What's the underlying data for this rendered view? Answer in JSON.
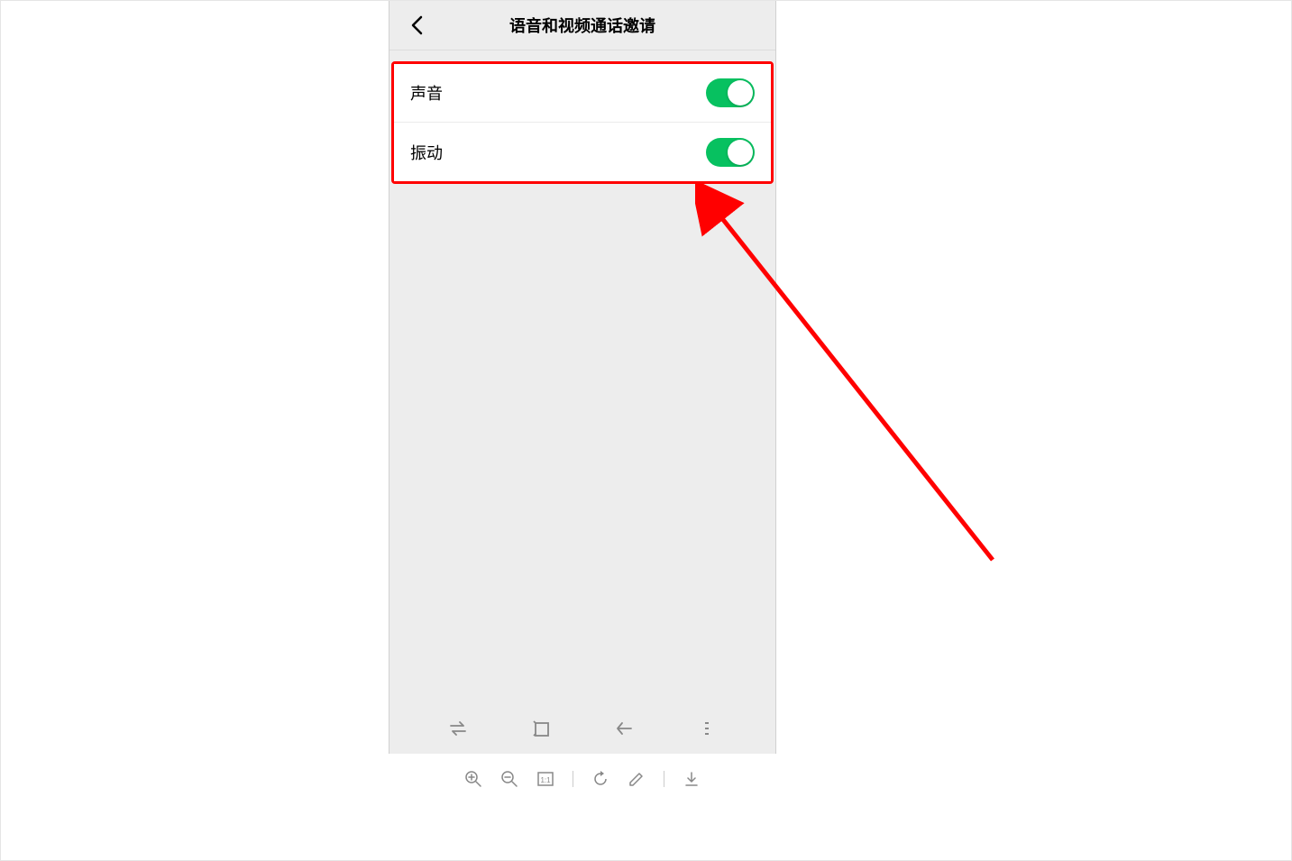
{
  "header": {
    "title": "语音和视频通话邀请"
  },
  "settings": {
    "items": [
      {
        "label": "声音",
        "enabled": true
      },
      {
        "label": "振动",
        "enabled": true
      }
    ]
  },
  "colors": {
    "toggle_on": "#07c160",
    "highlight_border": "#ff0000",
    "arrow": "#ff0000"
  }
}
